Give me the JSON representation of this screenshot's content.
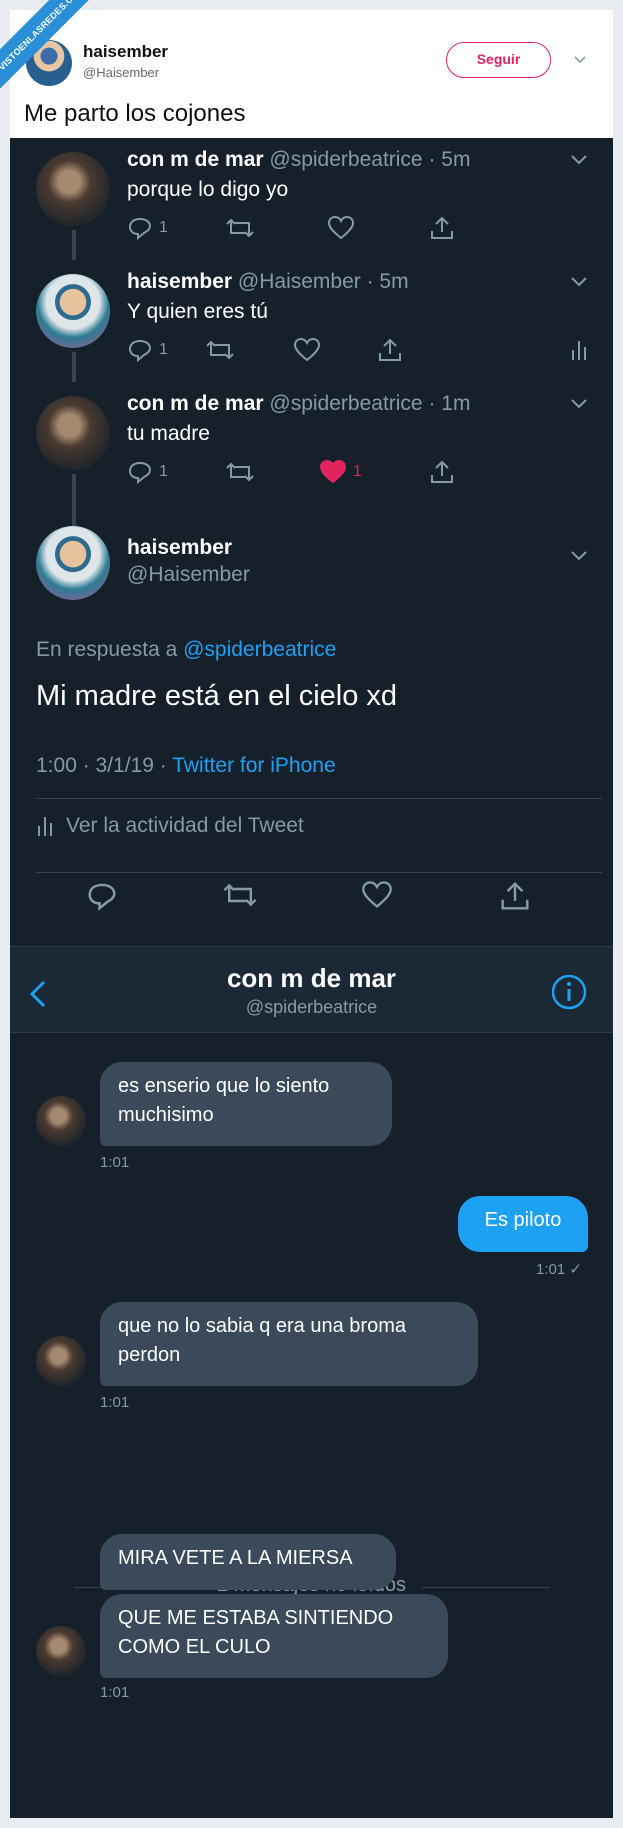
{
  "watermark": "VISTOENLASREDES.COM",
  "header": {
    "name": "haisember",
    "handle": "@Haisember",
    "follow_label": "Seguir",
    "tweet_text": "Me parto los cojones"
  },
  "thread": [
    {
      "name": "con m de mar",
      "meta": "@spiderbeatrice · 5m",
      "text": "porque lo digo yo",
      "reply_count": "1",
      "like_count": ""
    },
    {
      "name": "haisember",
      "meta": "@Haisember · 5m",
      "text": "Y quien eres tú",
      "reply_count": "1",
      "like_count": ""
    },
    {
      "name": "con m de mar",
      "meta": "@spiderbeatrice · 1m",
      "text": "tu madre",
      "reply_count": "1",
      "like_count": "1"
    }
  ],
  "main_tweet": {
    "name": "haisember",
    "handle": "@Haisember",
    "reply_prefix": "En respuesta a",
    "reply_to": "@spiderbeatrice",
    "text": "Mi madre está en el cielo xd",
    "time": "1:00 · 3/1/19 ·",
    "source": "Twitter for iPhone",
    "activity_label": "Ver la actividad del Tweet"
  },
  "dm": {
    "title": "con m de mar",
    "subtitle": "@spiderbeatrice",
    "messages": [
      {
        "line1": "es enserio que lo siento",
        "line2": "muchisimo",
        "time": "1:01"
      },
      {
        "text": "Es piloto",
        "time": "1:01 ✓"
      },
      {
        "line1": "que no lo sabia q era una broma",
        "line2": "perdon",
        "time": "1:01"
      },
      {
        "text": "MIRA VETE A LA MIERSA"
      },
      {
        "line1": "QUE ME ESTABA SINTIENDO",
        "line2": "COMO EL CULO",
        "time": "1:01"
      }
    ],
    "unread_label": "2 mensajes no leídos"
  },
  "colors": {
    "background_dark": "#15202b",
    "accent_blue": "#1da1f2",
    "like_red": "#e0245e",
    "muted": "#8899a6",
    "bubble_in": "#3a4a5a"
  }
}
